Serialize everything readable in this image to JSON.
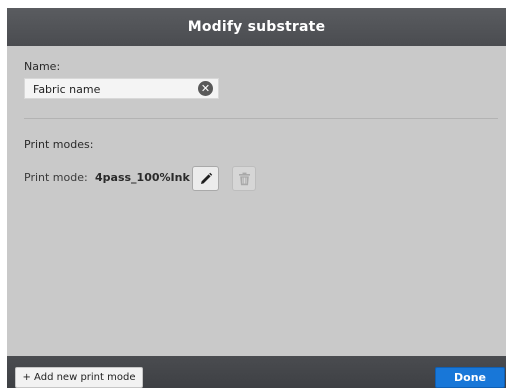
{
  "dialog": {
    "title": "Modify substrate"
  },
  "name": {
    "label": "Name:",
    "value": "Fabric name"
  },
  "print_modes": {
    "label": "Print modes:",
    "items": [
      {
        "prefix": "Print mode:",
        "value": "4pass_100%Ink"
      }
    ]
  },
  "footer": {
    "add_label": "+ Add new print mode",
    "done_label": "Done"
  },
  "icons": {
    "clear": "clear-icon",
    "edit": "pencil-icon",
    "delete": "trash-icon"
  },
  "colors": {
    "titlebar": "#4f5155",
    "background": "#c9c9c9",
    "done_button": "#1877d8"
  }
}
